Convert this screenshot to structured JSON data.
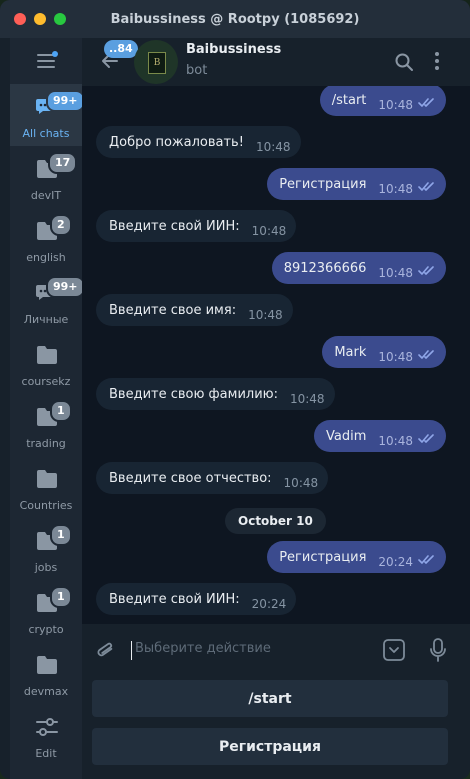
{
  "window": {
    "title": "Baibussiness @ Rootpy (1085692)"
  },
  "sidebar": {
    "folders": [
      {
        "label": "All chats",
        "badge": "99+",
        "icon": "chat-bubbles-icon"
      },
      {
        "label": "devIT",
        "badge": "17",
        "icon": "folder-icon"
      },
      {
        "label": "english",
        "badge": "2",
        "icon": "folder-icon"
      },
      {
        "label": "Личные",
        "badge": "99+",
        "icon": "chat-bubbles-icon"
      },
      {
        "label": "coursekz",
        "badge": "",
        "icon": "folder-icon"
      },
      {
        "label": "trading",
        "badge": "1",
        "icon": "folder-icon"
      },
      {
        "label": "Countries",
        "badge": "",
        "icon": "folder-icon"
      },
      {
        "label": "jobs",
        "badge": "1",
        "icon": "folder-icon"
      },
      {
        "label": "crypto",
        "badge": "1",
        "icon": "folder-icon"
      },
      {
        "label": "devmax",
        "badge": "",
        "icon": "folder-icon"
      },
      {
        "label": "Edit",
        "badge": "",
        "icon": "sliders-icon"
      }
    ]
  },
  "header": {
    "unread_count": "..84",
    "avatar_text": "B",
    "chat_name": "Baibussiness",
    "chat_status": "bot"
  },
  "messages": [
    {
      "dir": "out",
      "text": "/start",
      "time": "10:48"
    },
    {
      "dir": "in",
      "text": "Добро пожаловать!",
      "time": "10:48"
    },
    {
      "dir": "out",
      "text": "Регистрация",
      "time": "10:48"
    },
    {
      "dir": "in",
      "text": "Введите свой ИИН:",
      "time": "10:48"
    },
    {
      "dir": "out",
      "text": "8912366666",
      "time": "10:48"
    },
    {
      "dir": "in",
      "text": "Введите свое имя:",
      "time": "10:48"
    },
    {
      "dir": "out",
      "text": "Mark",
      "time": "10:48"
    },
    {
      "dir": "in",
      "text": "Введите свою фамилию:",
      "time": "10:48"
    },
    {
      "dir": "out",
      "text": "Vadim",
      "time": "10:48"
    },
    {
      "dir": "in",
      "text": "Введите свое отчество:",
      "time": "10:48"
    },
    {
      "dir": "out",
      "text": "Регистрация",
      "time": "20:24"
    },
    {
      "dir": "in",
      "text": "Введите свой ИИН:",
      "time": "20:24"
    }
  ],
  "date_separator": "October 10",
  "composer": {
    "placeholder": "Выберите действие"
  },
  "keyboard": {
    "buttons": [
      "/start",
      "Регистрация"
    ]
  },
  "colors": {
    "accent": "#5a9fe0",
    "outgoing_bubble": "#3b4b8e",
    "incoming_bubble": "#182533",
    "chat_bg": "#0e1621"
  }
}
